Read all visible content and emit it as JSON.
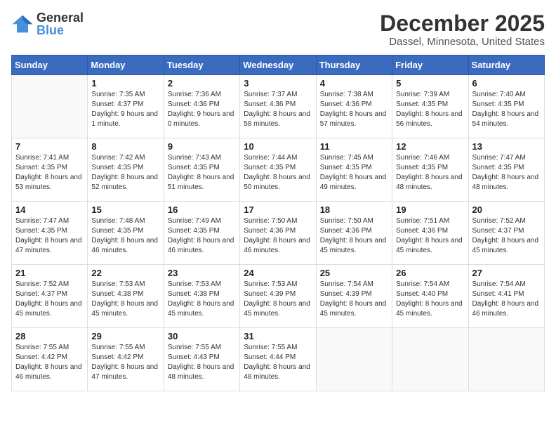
{
  "logo": {
    "general": "General",
    "blue": "Blue"
  },
  "header": {
    "month": "December 2025",
    "location": "Dassel, Minnesota, United States"
  },
  "weekdays": [
    "Sunday",
    "Monday",
    "Tuesday",
    "Wednesday",
    "Thursday",
    "Friday",
    "Saturday"
  ],
  "weeks": [
    [
      {
        "day": "",
        "sunrise": "",
        "sunset": "",
        "daylight": ""
      },
      {
        "day": "1",
        "sunrise": "Sunrise: 7:35 AM",
        "sunset": "Sunset: 4:37 PM",
        "daylight": "Daylight: 9 hours and 1 minute."
      },
      {
        "day": "2",
        "sunrise": "Sunrise: 7:36 AM",
        "sunset": "Sunset: 4:36 PM",
        "daylight": "Daylight: 9 hours and 0 minutes."
      },
      {
        "day": "3",
        "sunrise": "Sunrise: 7:37 AM",
        "sunset": "Sunset: 4:36 PM",
        "daylight": "Daylight: 8 hours and 58 minutes."
      },
      {
        "day": "4",
        "sunrise": "Sunrise: 7:38 AM",
        "sunset": "Sunset: 4:36 PM",
        "daylight": "Daylight: 8 hours and 57 minutes."
      },
      {
        "day": "5",
        "sunrise": "Sunrise: 7:39 AM",
        "sunset": "Sunset: 4:35 PM",
        "daylight": "Daylight: 8 hours and 56 minutes."
      },
      {
        "day": "6",
        "sunrise": "Sunrise: 7:40 AM",
        "sunset": "Sunset: 4:35 PM",
        "daylight": "Daylight: 8 hours and 54 minutes."
      }
    ],
    [
      {
        "day": "7",
        "sunrise": "Sunrise: 7:41 AM",
        "sunset": "Sunset: 4:35 PM",
        "daylight": "Daylight: 8 hours and 53 minutes."
      },
      {
        "day": "8",
        "sunrise": "Sunrise: 7:42 AM",
        "sunset": "Sunset: 4:35 PM",
        "daylight": "Daylight: 8 hours and 52 minutes."
      },
      {
        "day": "9",
        "sunrise": "Sunrise: 7:43 AM",
        "sunset": "Sunset: 4:35 PM",
        "daylight": "Daylight: 8 hours and 51 minutes."
      },
      {
        "day": "10",
        "sunrise": "Sunrise: 7:44 AM",
        "sunset": "Sunset: 4:35 PM",
        "daylight": "Daylight: 8 hours and 50 minutes."
      },
      {
        "day": "11",
        "sunrise": "Sunrise: 7:45 AM",
        "sunset": "Sunset: 4:35 PM",
        "daylight": "Daylight: 8 hours and 49 minutes."
      },
      {
        "day": "12",
        "sunrise": "Sunrise: 7:46 AM",
        "sunset": "Sunset: 4:35 PM",
        "daylight": "Daylight: 8 hours and 48 minutes."
      },
      {
        "day": "13",
        "sunrise": "Sunrise: 7:47 AM",
        "sunset": "Sunset: 4:35 PM",
        "daylight": "Daylight: 8 hours and 48 minutes."
      }
    ],
    [
      {
        "day": "14",
        "sunrise": "Sunrise: 7:47 AM",
        "sunset": "Sunset: 4:35 PM",
        "daylight": "Daylight: 8 hours and 47 minutes."
      },
      {
        "day": "15",
        "sunrise": "Sunrise: 7:48 AM",
        "sunset": "Sunset: 4:35 PM",
        "daylight": "Daylight: 8 hours and 46 minutes."
      },
      {
        "day": "16",
        "sunrise": "Sunrise: 7:49 AM",
        "sunset": "Sunset: 4:35 PM",
        "daylight": "Daylight: 8 hours and 46 minutes."
      },
      {
        "day": "17",
        "sunrise": "Sunrise: 7:50 AM",
        "sunset": "Sunset: 4:36 PM",
        "daylight": "Daylight: 8 hours and 46 minutes."
      },
      {
        "day": "18",
        "sunrise": "Sunrise: 7:50 AM",
        "sunset": "Sunset: 4:36 PM",
        "daylight": "Daylight: 8 hours and 45 minutes."
      },
      {
        "day": "19",
        "sunrise": "Sunrise: 7:51 AM",
        "sunset": "Sunset: 4:36 PM",
        "daylight": "Daylight: 8 hours and 45 minutes."
      },
      {
        "day": "20",
        "sunrise": "Sunrise: 7:52 AM",
        "sunset": "Sunset: 4:37 PM",
        "daylight": "Daylight: 8 hours and 45 minutes."
      }
    ],
    [
      {
        "day": "21",
        "sunrise": "Sunrise: 7:52 AM",
        "sunset": "Sunset: 4:37 PM",
        "daylight": "Daylight: 8 hours and 45 minutes."
      },
      {
        "day": "22",
        "sunrise": "Sunrise: 7:53 AM",
        "sunset": "Sunset: 4:38 PM",
        "daylight": "Daylight: 8 hours and 45 minutes."
      },
      {
        "day": "23",
        "sunrise": "Sunrise: 7:53 AM",
        "sunset": "Sunset: 4:38 PM",
        "daylight": "Daylight: 8 hours and 45 minutes."
      },
      {
        "day": "24",
        "sunrise": "Sunrise: 7:53 AM",
        "sunset": "Sunset: 4:39 PM",
        "daylight": "Daylight: 8 hours and 45 minutes."
      },
      {
        "day": "25",
        "sunrise": "Sunrise: 7:54 AM",
        "sunset": "Sunset: 4:39 PM",
        "daylight": "Daylight: 8 hours and 45 minutes."
      },
      {
        "day": "26",
        "sunrise": "Sunrise: 7:54 AM",
        "sunset": "Sunset: 4:40 PM",
        "daylight": "Daylight: 8 hours and 45 minutes."
      },
      {
        "day": "27",
        "sunrise": "Sunrise: 7:54 AM",
        "sunset": "Sunset: 4:41 PM",
        "daylight": "Daylight: 8 hours and 46 minutes."
      }
    ],
    [
      {
        "day": "28",
        "sunrise": "Sunrise: 7:55 AM",
        "sunset": "Sunset: 4:42 PM",
        "daylight": "Daylight: 8 hours and 46 minutes."
      },
      {
        "day": "29",
        "sunrise": "Sunrise: 7:55 AM",
        "sunset": "Sunset: 4:42 PM",
        "daylight": "Daylight: 8 hours and 47 minutes."
      },
      {
        "day": "30",
        "sunrise": "Sunrise: 7:55 AM",
        "sunset": "Sunset: 4:43 PM",
        "daylight": "Daylight: 8 hours and 48 minutes."
      },
      {
        "day": "31",
        "sunrise": "Sunrise: 7:55 AM",
        "sunset": "Sunset: 4:44 PM",
        "daylight": "Daylight: 8 hours and 48 minutes."
      },
      {
        "day": "",
        "sunrise": "",
        "sunset": "",
        "daylight": ""
      },
      {
        "day": "",
        "sunrise": "",
        "sunset": "",
        "daylight": ""
      },
      {
        "day": "",
        "sunrise": "",
        "sunset": "",
        "daylight": ""
      }
    ]
  ]
}
